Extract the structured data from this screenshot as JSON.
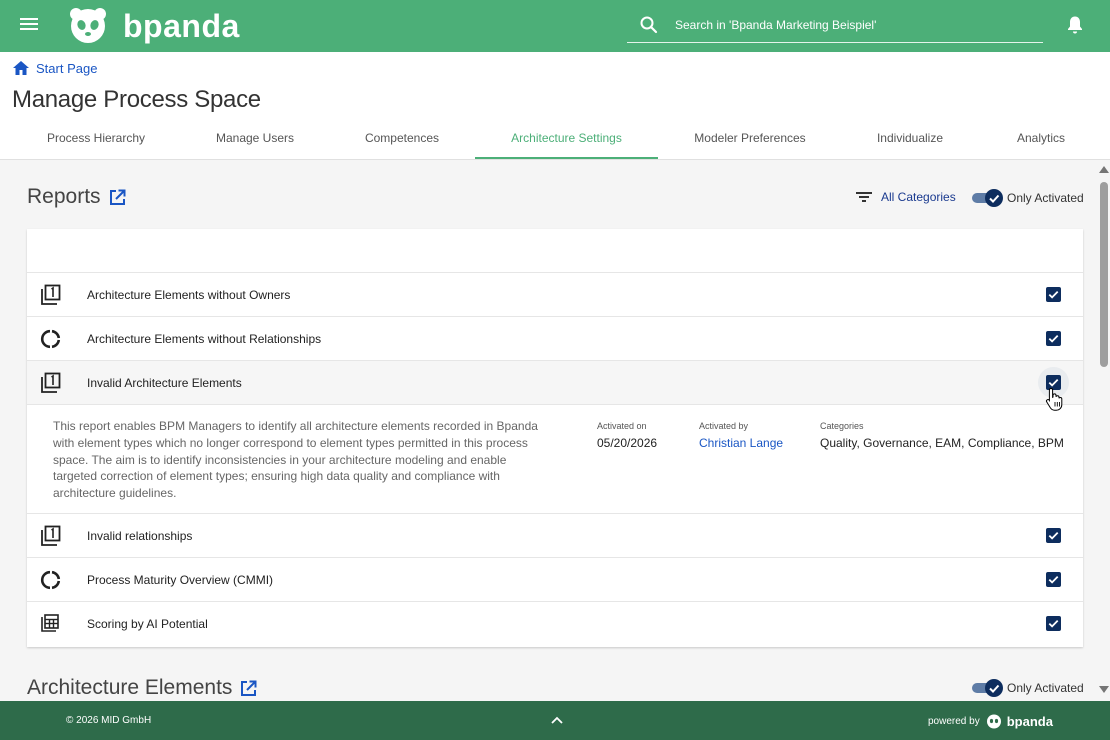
{
  "header": {
    "brand": "bpanda",
    "search_placeholder": "Search in 'Bpanda Marketing Beispiel'"
  },
  "breadcrumb": {
    "home_label": "Start Page"
  },
  "page_title": "Manage Process Space",
  "tabs": [
    {
      "label": "Process Hierarchy"
    },
    {
      "label": "Manage Users"
    },
    {
      "label": "Competences"
    },
    {
      "label": "Architecture Settings",
      "active": true
    },
    {
      "label": "Modeler Preferences"
    },
    {
      "label": "Individualize"
    },
    {
      "label": "Analytics"
    }
  ],
  "reports": {
    "title": "Reports",
    "filter_label": "All Categories",
    "toggle_label": "Only Activated",
    "rows": [
      {
        "label": "Architecture Elements without Owners",
        "icon": "numbered-list-icon",
        "checked": true
      },
      {
        "label": "Architecture Elements without Relationships",
        "icon": "donut-chart-icon",
        "checked": true
      },
      {
        "label": "Invalid Architecture Elements",
        "icon": "numbered-list-icon",
        "checked": true
      },
      {
        "label": "Invalid relationships",
        "icon": "numbered-list-icon",
        "checked": true
      },
      {
        "label": "Process Maturity Overview (CMMI)",
        "icon": "donut-chart-icon",
        "checked": true
      },
      {
        "label": "Scoring by AI Potential",
        "icon": "table-grid-icon",
        "checked": true
      }
    ],
    "detail": {
      "description": "This report enables BPM Managers to identify all architecture elements recorded in Bpanda with element types which no longer correspond to element types permitted in this process space. The aim is to identify inconsistencies in your architecture modeling and enable targeted correction of element types; ensuring high data quality and compliance with architecture guidelines.",
      "activated_on_label": "Activated on",
      "activated_on": "05/20/2026",
      "activated_by_label": "Activated by",
      "activated_by": "Christian Lange",
      "categories_label": "Categories",
      "categories": "Quality, Governance, EAM, Compliance, BPM"
    }
  },
  "architecture_elements": {
    "title": "Architecture Elements",
    "toggle_label": "Only Activated"
  },
  "footer": {
    "copyright": "© 2026 MID GmbH",
    "powered_by": "powered by",
    "brand": "bpanda"
  },
  "colors": {
    "header_green": "#4caf78",
    "footer_green": "#2e6b4a",
    "checkbox_navy": "#0d2d5e",
    "link_blue": "#1a56c4"
  }
}
